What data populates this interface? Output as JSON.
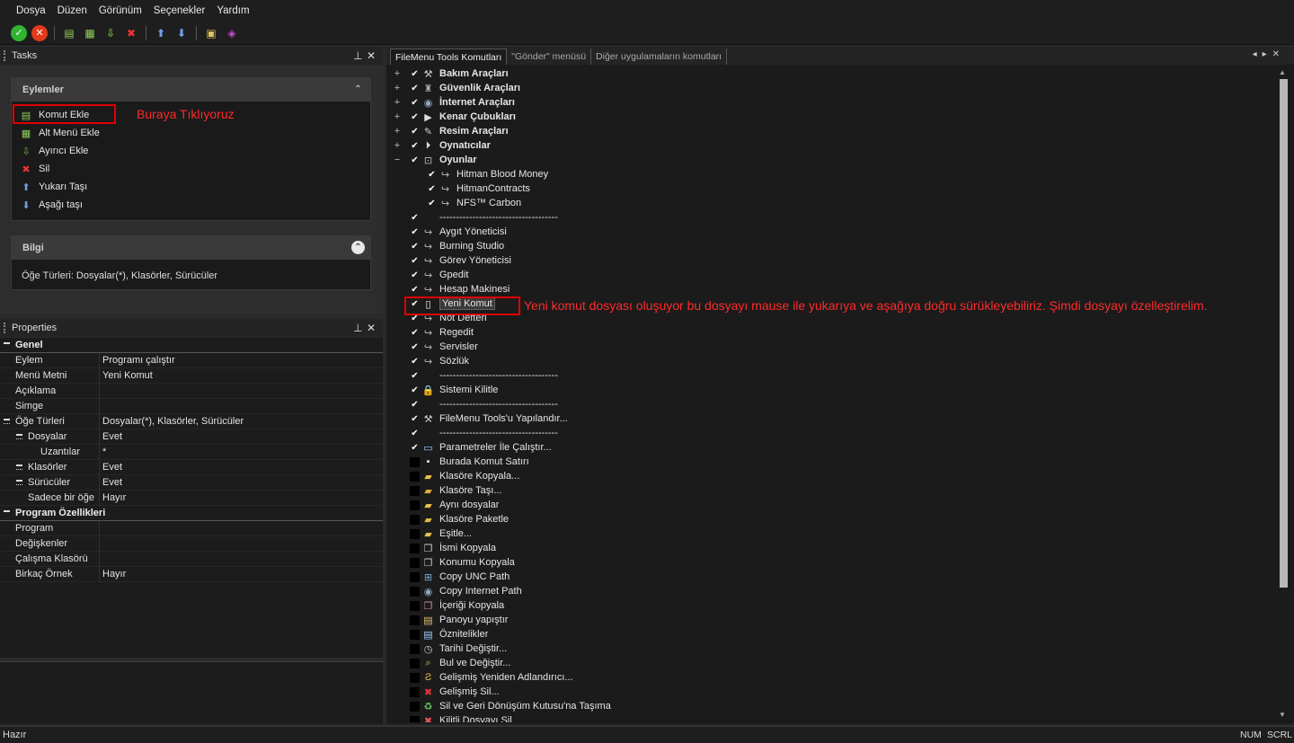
{
  "menu": [
    "Dosya",
    "Düzen",
    "Görünüm",
    "Seçenekler",
    "Yardım"
  ],
  "tasks": {
    "title": "Tasks",
    "actions_title": "Eylemler",
    "actions": [
      "Komut Ekle",
      "Alt Menü Ekle",
      "Ayırıcı Ekle",
      "Sil",
      "Yukarı Taşı",
      "Aşağı taşı"
    ],
    "annotation": "Buraya Tıklıyoruz",
    "info_title": "Bilgi",
    "info_text": "Öğe Türleri: Dosyalar(*), Klasörler, Sürücüler"
  },
  "properties": {
    "title": "Properties",
    "rows": [
      {
        "key": "Genel",
        "value": "",
        "cat": true
      },
      {
        "key": "Eylem",
        "value": "Programı çalıştır"
      },
      {
        "key": "Menü Metni",
        "value": "Yeni Komut"
      },
      {
        "key": "Açıklama",
        "value": ""
      },
      {
        "key": "Simge",
        "value": ""
      },
      {
        "key": "Öğe Türleri",
        "value": "Dosyalar(*), Klasörler, Sürücüler",
        "exp": true
      },
      {
        "key": "Dosyalar",
        "value": "Evet",
        "sub": 1,
        "exp": true
      },
      {
        "key": "Uzantılar",
        "value": "*",
        "sub": 2
      },
      {
        "key": "Klasörler",
        "value": "Evet",
        "sub": 1,
        "exp": true
      },
      {
        "key": "Sürücüler",
        "value": "Evet",
        "sub": 1,
        "exp": true
      },
      {
        "key": "Sadece bir öğe",
        "value": "Hayır",
        "sub": 1
      },
      {
        "key": "Program Özellikleri",
        "value": "",
        "cat": true
      },
      {
        "key": "Program",
        "value": ""
      },
      {
        "key": "Değişkenler",
        "value": ""
      },
      {
        "key": "Çalışma Klasörü",
        "value": ""
      },
      {
        "key": "Birkaç Örnek",
        "value": "Hayır"
      }
    ]
  },
  "tabs": [
    "FileMenu Tools Komutları",
    "\"Gönder\" menüsü",
    "Diğer uygulamaların komutları"
  ],
  "tree_annotation": "Yeni komut dosyası oluşuyor bu dosyayı mause ile yukarıya ve aşağıya doğru sürükleyebiliriz. Şimdi dosyayı özelleştirelim.",
  "tree": [
    {
      "label": "Bakım Araçları",
      "lvl": 0,
      "exp": "+",
      "chk": true,
      "bold": true,
      "icon": "tools-icon"
    },
    {
      "label": "Güvenlik Araçları",
      "lvl": 0,
      "exp": "+",
      "chk": true,
      "bold": true,
      "icon": "castle-icon"
    },
    {
      "label": "İnternet Araçları",
      "lvl": 0,
      "exp": "+",
      "chk": true,
      "bold": true,
      "icon": "globe-icon"
    },
    {
      "label": "Kenar Çubukları",
      "lvl": 0,
      "exp": "+",
      "chk": true,
      "bold": true,
      "icon": "arrow-icon"
    },
    {
      "label": "Resim Araçları",
      "lvl": 0,
      "exp": "+",
      "chk": true,
      "bold": true,
      "icon": "brush-icon"
    },
    {
      "label": "Oynatıcılar",
      "lvl": 0,
      "exp": "+",
      "chk": true,
      "bold": true,
      "icon": "play-icon"
    },
    {
      "label": "Oyunlar",
      "lvl": 0,
      "exp": "−",
      "chk": true,
      "bold": true,
      "icon": "gamepad-icon"
    },
    {
      "label": "Hitman Blood Money",
      "lvl": 1,
      "chk": true,
      "icon": "share-arrow-icon"
    },
    {
      "label": "HitmanContracts",
      "lvl": 1,
      "chk": true,
      "icon": "share-arrow-icon"
    },
    {
      "label": "NFS™ Carbon",
      "lvl": 1,
      "chk": true,
      "icon": "share-arrow-icon"
    },
    {
      "label": "------------------------------------",
      "lvl": 0,
      "chk": true,
      "icon": ""
    },
    {
      "label": "Aygıt Yöneticisi",
      "lvl": 0,
      "chk": true,
      "icon": "share-arrow-icon"
    },
    {
      "label": "Burning Studio",
      "lvl": 0,
      "chk": true,
      "icon": "share-arrow-icon"
    },
    {
      "label": "Görev Yöneticisi",
      "lvl": 0,
      "chk": true,
      "icon": "share-arrow-icon"
    },
    {
      "label": "Gpedit",
      "lvl": 0,
      "chk": true,
      "icon": "share-arrow-icon"
    },
    {
      "label": "Hesap Makinesi",
      "lvl": 0,
      "chk": true,
      "icon": "share-arrow-icon"
    },
    {
      "label": "Yeni Komut",
      "lvl": 0,
      "chk": true,
      "icon": "file-icon",
      "sel": true
    },
    {
      "label": "Not Defteri",
      "lvl": 0,
      "chk": true,
      "icon": "share-arrow-icon"
    },
    {
      "label": "Regedit",
      "lvl": 0,
      "chk": true,
      "icon": "share-arrow-icon"
    },
    {
      "label": "Servisler",
      "lvl": 0,
      "chk": true,
      "icon": "share-arrow-icon"
    },
    {
      "label": "Sözlük",
      "lvl": 0,
      "chk": true,
      "icon": "share-arrow-icon"
    },
    {
      "label": "------------------------------------",
      "lvl": 0,
      "chk": true,
      "icon": ""
    },
    {
      "label": "Sistemi Kilitle",
      "lvl": 0,
      "chk": true,
      "icon": "lock-icon"
    },
    {
      "label": "------------------------------------",
      "lvl": 0,
      "chk": true,
      "icon": ""
    },
    {
      "label": "FileMenu Tools'u Yapılandır...",
      "lvl": 0,
      "chk": true,
      "icon": "tools-icon"
    },
    {
      "label": "------------------------------------",
      "lvl": 0,
      "chk": true,
      "icon": ""
    },
    {
      "label": "Parametreler İle Çalıştır...",
      "lvl": 0,
      "chk": true,
      "icon": "run-icon"
    },
    {
      "label": "Burada Komut Satırı",
      "lvl": 0,
      "chk": false,
      "icon": "console-icon"
    },
    {
      "label": "Klasöre Kopyala...",
      "lvl": 0,
      "chk": false,
      "icon": "folder-copy-icon"
    },
    {
      "label": "Klasöre Taşı...",
      "lvl": 0,
      "chk": false,
      "icon": "folder-move-icon"
    },
    {
      "label": "Aynı dosyalar",
      "lvl": 0,
      "chk": false,
      "icon": "folder-icon"
    },
    {
      "label": "Klasöre Paketle",
      "lvl": 0,
      "chk": false,
      "icon": "folder-pack-icon"
    },
    {
      "label": "Eşitle...",
      "lvl": 0,
      "chk": false,
      "icon": "folder-sync-icon"
    },
    {
      "label": "İsmi Kopyala",
      "lvl": 0,
      "chk": false,
      "icon": "copy-icon"
    },
    {
      "label": "Konumu Kopyala",
      "lvl": 0,
      "chk": false,
      "icon": "copy-icon"
    },
    {
      "label": "Copy UNC Path",
      "lvl": 0,
      "chk": false,
      "icon": "network-icon"
    },
    {
      "label": "Copy Internet Path",
      "lvl": 0,
      "chk": false,
      "icon": "globe-icon"
    },
    {
      "label": "İçeriği Kopyala",
      "lvl": 0,
      "chk": false,
      "icon": "copy-content-icon"
    },
    {
      "label": "Panoyu yapıştır",
      "lvl": 0,
      "chk": false,
      "icon": "clipboard-icon"
    },
    {
      "label": "Öznitelikler",
      "lvl": 0,
      "chk": false,
      "icon": "attributes-icon"
    },
    {
      "label": "Tarihi Değiştir...",
      "lvl": 0,
      "chk": false,
      "icon": "date-icon"
    },
    {
      "label": "Bul ve Değiştir...",
      "lvl": 0,
      "chk": false,
      "icon": "find-icon"
    },
    {
      "label": "Gelişmiş Yeniden Adlandırıcı...",
      "lvl": 0,
      "chk": false,
      "icon": "rename-icon"
    },
    {
      "label": "Gelişmiş Sil...",
      "lvl": 0,
      "chk": false,
      "icon": "delete-icon"
    },
    {
      "label": "Sil ve Geri Dönüşüm Kutusu'na Taşıma",
      "lvl": 0,
      "chk": false,
      "icon": "recycle-icon"
    },
    {
      "label": "Kilitli Dosyayı Sil",
      "lvl": 0,
      "chk": false,
      "icon": "lock-delete-icon"
    }
  ],
  "status": {
    "left": "Hazır",
    "num": "NUM",
    "scrl": "SCRL"
  }
}
